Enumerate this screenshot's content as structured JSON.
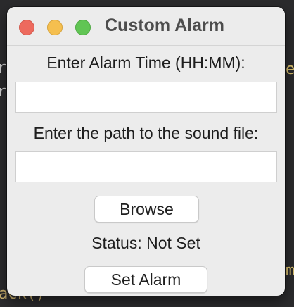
{
  "window": {
    "title": "Custom Alarm"
  },
  "alarm_time": {
    "label": "Enter Alarm Time (HH:MM):",
    "value": "",
    "placeholder": ""
  },
  "sound_path": {
    "label": "Enter the path to the sound file:",
    "value": "",
    "placeholder": ""
  },
  "buttons": {
    "browse": "Browse",
    "set_alarm": "Set Alarm"
  },
  "status": {
    "text": "Status: Not Set"
  },
  "background_editor": {
    "visible_fragment": "ack()"
  },
  "colors": {
    "close": "#ed6a5e",
    "minimize": "#f5bf4f",
    "maximize": "#61c554",
    "window_bg": "#ececec",
    "editor_bg": "#2b2b2d"
  }
}
